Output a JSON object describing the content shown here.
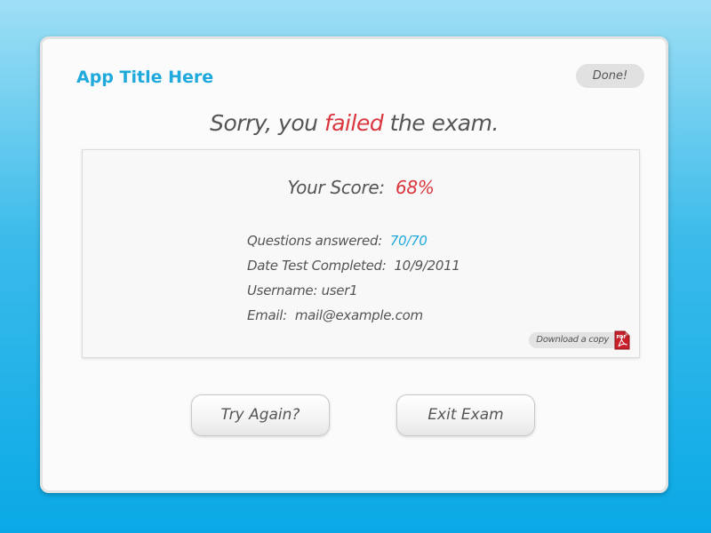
{
  "app": {
    "title": "App Title Here",
    "done_label": "Done!"
  },
  "headline": {
    "prefix": "Sorry, you ",
    "highlight": "failed",
    "suffix": " the exam."
  },
  "score": {
    "label": "Your Score:",
    "value": "68%"
  },
  "details": {
    "questions_label": "Questions answered:",
    "questions_value": "70/70",
    "date_label": "Date Test Completed:",
    "date_value": "10/9/2011",
    "username_label": "Username:",
    "username_value": "user1",
    "email_label": "Email:",
    "email_value": "mail@example.com"
  },
  "download": {
    "label": "Download a copy",
    "icon": "pdf-icon",
    "icon_text": "PDF"
  },
  "actions": {
    "try_again": "Try Again?",
    "exit": "Exit Exam"
  },
  "colors": {
    "accent": "#1fa9dc",
    "fail": "#d9363e",
    "text": "#555555",
    "background_top": "#9fdff5",
    "background_bottom": "#0aa9e6"
  }
}
